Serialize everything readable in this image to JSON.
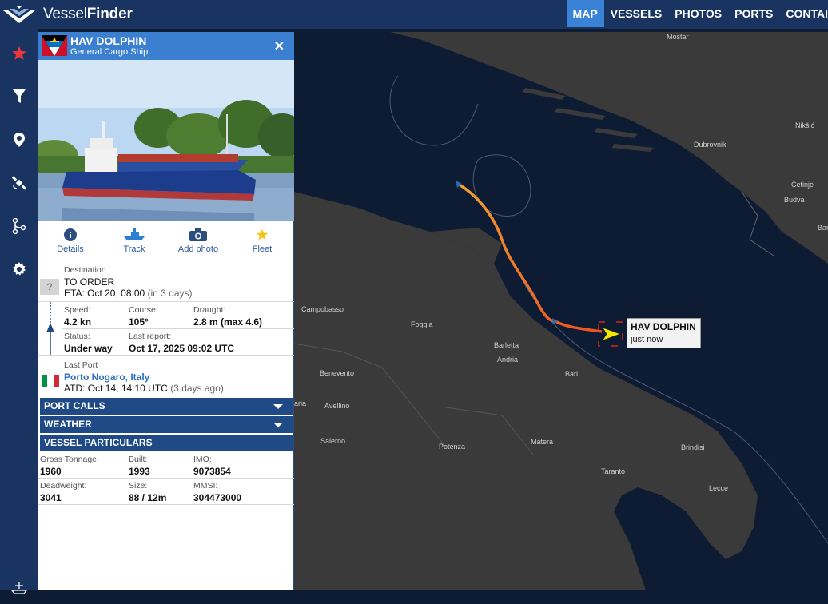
{
  "app": {
    "logo_light": "Vessel",
    "logo_bold": "Finder"
  },
  "nav": {
    "items": [
      "MAP",
      "VESSELS",
      "PHOTOS",
      "PORTS",
      "CONTAI"
    ],
    "active": "MAP"
  },
  "rail": {
    "icons": [
      "star-icon",
      "filter-icon",
      "pin-icon",
      "satellite-icon",
      "route-icon",
      "gear-icon",
      "ship-icon"
    ]
  },
  "vessel": {
    "name": "HAV DOLPHIN",
    "type": "General Cargo Ship",
    "flag": "Antigua and Barbuda"
  },
  "actions": {
    "details": "Details",
    "track": "Track",
    "add_photo": "Add photo",
    "fleet": "Fleet"
  },
  "voyage": {
    "destination_label": "Destination",
    "destination": "TO ORDER",
    "eta_label": "ETA:",
    "eta_value": "Oct 20, 08:00",
    "eta_rel": "(in 3 days)",
    "unknown_port": "?",
    "speed_label": "Speed:",
    "speed": "4.2 kn",
    "course_label": "Course:",
    "course": "105°",
    "draught_label": "Draught:",
    "draught": "2.8 m (max 4.6)",
    "status_label": "Status:",
    "status": "Under way",
    "last_report_label": "Last report:",
    "last_report": "Oct 17, 2025 09:02 UTC",
    "last_port_label": "Last Port",
    "last_port": "Porto Nogaro, Italy",
    "atd_label": "ATD:",
    "atd_value": "Oct 14, 14:10 UTC",
    "atd_rel": "(3 days ago)"
  },
  "sections": {
    "port_calls": "PORT CALLS",
    "weather": "WEATHER",
    "particulars": "VESSEL PARTICULARS"
  },
  "particulars": {
    "gross_tonnage_label": "Gross Tonnage:",
    "gross_tonnage": "1960",
    "built_label": "Built:",
    "built": "1993",
    "imo_label": "IMO:",
    "imo": "9073854",
    "deadweight_label": "Deadweight:",
    "deadweight": "3041",
    "size_label": "Size:",
    "size": "88 / 12m",
    "mmsi_label": "MMSI:",
    "mmsi": "304473000"
  },
  "map": {
    "labels": [
      "Mostar",
      "Nikšić",
      "Dubrovnik",
      "Cetinje",
      "Budva",
      "Bar",
      "Campobasso",
      "Foggia",
      "Barletta",
      "Andria",
      "Bari",
      "Benevento",
      "Avellino",
      "aria",
      "Salerno",
      "Potenza",
      "Matera",
      "Brindisi",
      "Taranto",
      "Lecce"
    ],
    "tooltip_name": "HAV DOLPHIN",
    "tooltip_time": "just now"
  },
  "colors": {
    "topbar": "#1a3461",
    "accent": "#3a7fd0",
    "section": "#1f4a86",
    "sea": "#0d1b33",
    "land": "#3a3a3a",
    "track_start": "#f0a030",
    "track_end": "#f05020"
  }
}
